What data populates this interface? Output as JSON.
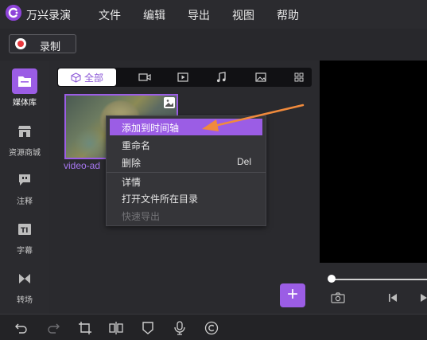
{
  "app": {
    "title": "万兴录演"
  },
  "menu": [
    "文件",
    "编辑",
    "导出",
    "视图",
    "帮助"
  ],
  "toolbar": {
    "record_label": "录制"
  },
  "leftnav": [
    {
      "icon": "folder-icon",
      "label": "媒体库",
      "active": true
    },
    {
      "icon": "store-icon",
      "label": "资源商城",
      "active": false
    },
    {
      "icon": "comment-icon",
      "label": "注释",
      "active": false
    },
    {
      "icon": "caption-icon",
      "label": "字幕",
      "active": false
    },
    {
      "icon": "transition-icon",
      "label": "转场",
      "active": false
    }
  ],
  "media": {
    "tabs": [
      {
        "icon": "cube-icon",
        "label": "全部",
        "active": true
      },
      {
        "icon": "video-camera-icon",
        "label": ""
      },
      {
        "icon": "play-screen-icon",
        "label": ""
      },
      {
        "icon": "music-note-icon",
        "label": ""
      },
      {
        "icon": "image-icon",
        "label": ""
      },
      {
        "icon": "grid-icon",
        "label": ""
      }
    ],
    "clip": {
      "name": "video-ad"
    }
  },
  "context_menu": {
    "items": [
      {
        "label": "添加到时间轴",
        "shortcut": "",
        "highlighted": true,
        "disabled": false
      },
      {
        "label": "重命名",
        "shortcut": "",
        "highlighted": false,
        "disabled": false
      },
      {
        "label": "删除",
        "shortcut": "Del",
        "highlighted": false,
        "disabled": false
      },
      {
        "label": "详情",
        "shortcut": "",
        "highlighted": false,
        "disabled": false
      },
      {
        "label": "打开文件所在目录",
        "shortcut": "",
        "highlighted": false,
        "disabled": false
      },
      {
        "label": "快速导出",
        "shortcut": "",
        "highlighted": false,
        "disabled": true
      }
    ]
  },
  "preview": {
    "progress": 0.0
  },
  "colors": {
    "accent": "#9b5de5",
    "annotation_arrow": "#f08a3c",
    "record_red": "#e8383d"
  }
}
